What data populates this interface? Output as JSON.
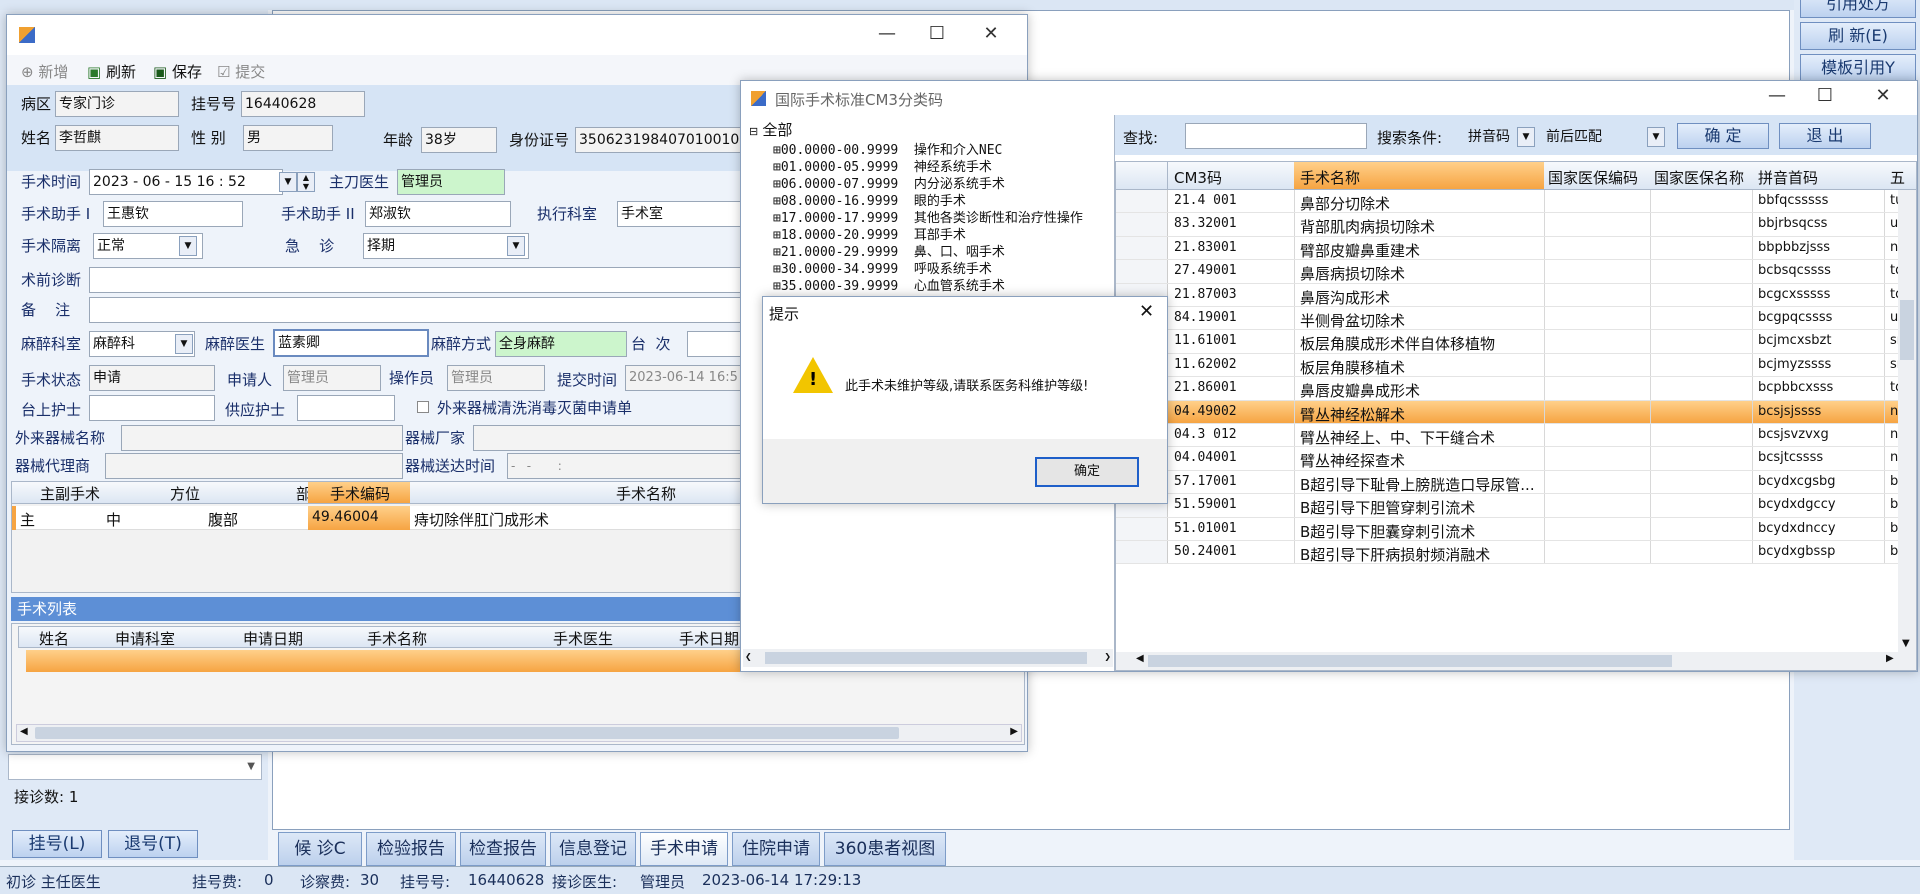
{
  "main_window": {
    "right_buttons": [
      "引用处方",
      "刷 新(E)",
      "模板引用Y"
    ],
    "bottom_left": {
      "visit_count": "接诊数: 1",
      "btn_register": "挂号(L)",
      "btn_unregister": "退号(T)"
    },
    "bottom_tabs": [
      "候 诊C",
      "检验报告",
      "检查报告",
      "信息登记",
      "手术申请",
      "住院申请",
      "360患者视图"
    ],
    "status_bar": {
      "visit_type": "初诊 主任医生",
      "reg_fee_label": "挂号费:",
      "reg_fee": "0",
      "diag_fee_label": "诊察费:",
      "diag_fee": "30",
      "reg_no_label": "挂号号:",
      "reg_no": "16440628",
      "doctor_label": "接诊医生:",
      "doctor": "管理员",
      "datetime": "2023-06-14 17:29:13"
    }
  },
  "surgery_window": {
    "toolbar": {
      "new": "新增",
      "refresh": "刷新",
      "save": "保存",
      "submit": "提交"
    },
    "patient": {
      "ward_label": "病区",
      "ward": "专家门诊",
      "regno_label": "挂号号",
      "regno": "16440628",
      "name_label": "姓名",
      "name": "李哲麒",
      "gender_label": "性 别",
      "gender": "男",
      "age_label": "年龄",
      "age": "38岁",
      "id_label": "身份证号",
      "id": "350623198407010010"
    },
    "form": {
      "time_label": "手术时间",
      "time": "2023 - 06 - 15   16 : 52",
      "surgeon_label": "主刀医生",
      "surgeon": "管理员",
      "assist1_label": "手术助手 I",
      "assist1": "王惠钦",
      "assist2_label": "手术助手 II",
      "assist2": "郑淑钦",
      "dept_label": "执行科室",
      "dept": "手术室",
      "isolation_label": "手术隔离",
      "isolation": "正常",
      "emergency_label": "急    诊",
      "emergency": "择期",
      "prediag_label": "术前诊断",
      "remark_label": "备    注",
      "anes_dept_label": "麻醉科室",
      "anes_dept": "麻醉科",
      "anes_doc_label": "麻醉医生",
      "anes_doc": "蓝素卿",
      "anes_method_label": "麻醉方式",
      "anes_method": "全身麻醉",
      "table_label": "台  次",
      "status_label": "手术状态",
      "status": "申请",
      "applicant_label": "申请人",
      "applicant": "管理员",
      "operator_label": "操作员",
      "operator": "管理员",
      "submit_time_label": "提交时间",
      "submit_time": "2023-06-14 16:5",
      "nurse1_label": "台上护士",
      "nurse2_label": "供应护士",
      "external_check": "外来器械清洗消毒灭菌申请单",
      "ext_name_label": "外来器械名称",
      "ext_maker_label": "器械厂家",
      "ext_agent_label": "器械代理商",
      "ext_arrive_label": "器械送达时间",
      "ext_arrive_value": "-   -       :"
    },
    "ops_table": {
      "headers": [
        "主副手术",
        "方位",
        "部位",
        "手术编码",
        "手术名称"
      ],
      "row": [
        "主",
        "中",
        "腹部",
        "49.46004",
        "痔切除伴肛门成形术"
      ]
    },
    "list_title": "手术列表",
    "list_headers": [
      "姓名",
      "申请科室",
      "申请日期",
      "手术名称",
      "手术医生",
      "手术日期"
    ]
  },
  "cm3_window": {
    "title": "国际手术标准CM3分类码",
    "tree": [
      "全部",
      "00.0000-00.9999  操作和介入NEC",
      "01.0000-05.9999  神经系统手术",
      "06.0000-07.9999  内分泌系统手术",
      "08.0000-16.9999  眼的手术",
      "17.0000-17.9999  其他各类诊断性和治疗性操作",
      "18.0000-20.9999  耳部手术",
      "21.0000-29.9999  鼻、口、咽手术",
      "30.0000-34.9999  呼吸系统手术",
      "35.0000-39.9999  心血管系统手术"
    ],
    "search_label": "查找:",
    "cond_label": "搜索条件:",
    "cond_value": "拼音码",
    "match_value": "前后匹配",
    "ok": "确 定",
    "exit": "退 出",
    "headers": [
      "CM3码",
      "手术名称",
      "国家医保编码",
      "国家医保名称",
      "拼音首码",
      "五"
    ],
    "rows": [
      [
        "21.4 001",
        "鼻部分切除术",
        "bbfqcsssss",
        "tu"
      ],
      [
        "83.32001",
        "背部肌肉病损切除术",
        "bbjrbsqcss",
        "uu"
      ],
      [
        "21.83001",
        "臂部皮瓣鼻重建术",
        "bbpbbzjsss",
        "nu"
      ],
      [
        "27.49001",
        "鼻唇病损切除术",
        "bcbsqcssss",
        "td"
      ],
      [
        "21.87003",
        "鼻唇沟成形术",
        "bcgcxsssss",
        "td"
      ],
      [
        "84.19001",
        "半侧骨盆切除术",
        "bcgpqcssss",
        "uw"
      ],
      [
        "11.61001",
        "板层角膜成形术伴自体移植物",
        "bcjmcxsbzt",
        "sn"
      ],
      [
        "11.62002",
        "板层角膜移植术",
        "bcjmyzssss",
        "sn"
      ],
      [
        "21.86001",
        "鼻唇皮瓣鼻成形术",
        "bcpbbcxsss",
        "td"
      ],
      [
        "04.49002",
        "臂丛神经松解术",
        "bcsjsjssss",
        "nw"
      ],
      [
        "04.3 012",
        "臂丛神经上、中、下干缝合术",
        "bcsjsvzvxg",
        "nw"
      ],
      [
        "04.04001",
        "臂丛神经探查术",
        "bcsjtcssss",
        "nw"
      ],
      [
        "57.17001",
        "B超引导下耻骨上膀胱造口导尿管...",
        "bcydxcgsbg",
        "bf"
      ],
      [
        "51.59001",
        "B超引导下胆管穿刺引流术",
        "bcydxdgccy",
        "bf"
      ],
      [
        "51.01001",
        "B超引导下胆囊穿刺引流术",
        "bcydxdnccy",
        "bf"
      ],
      [
        "50.24001",
        "B超引导下肝病损射频消融术",
        "bcydxgbssp",
        "bf"
      ]
    ],
    "selected_index": 9
  },
  "dialog": {
    "title": "提示",
    "message": "此手术未维护等级,请联系医务科维护等级!",
    "ok": "确定"
  }
}
